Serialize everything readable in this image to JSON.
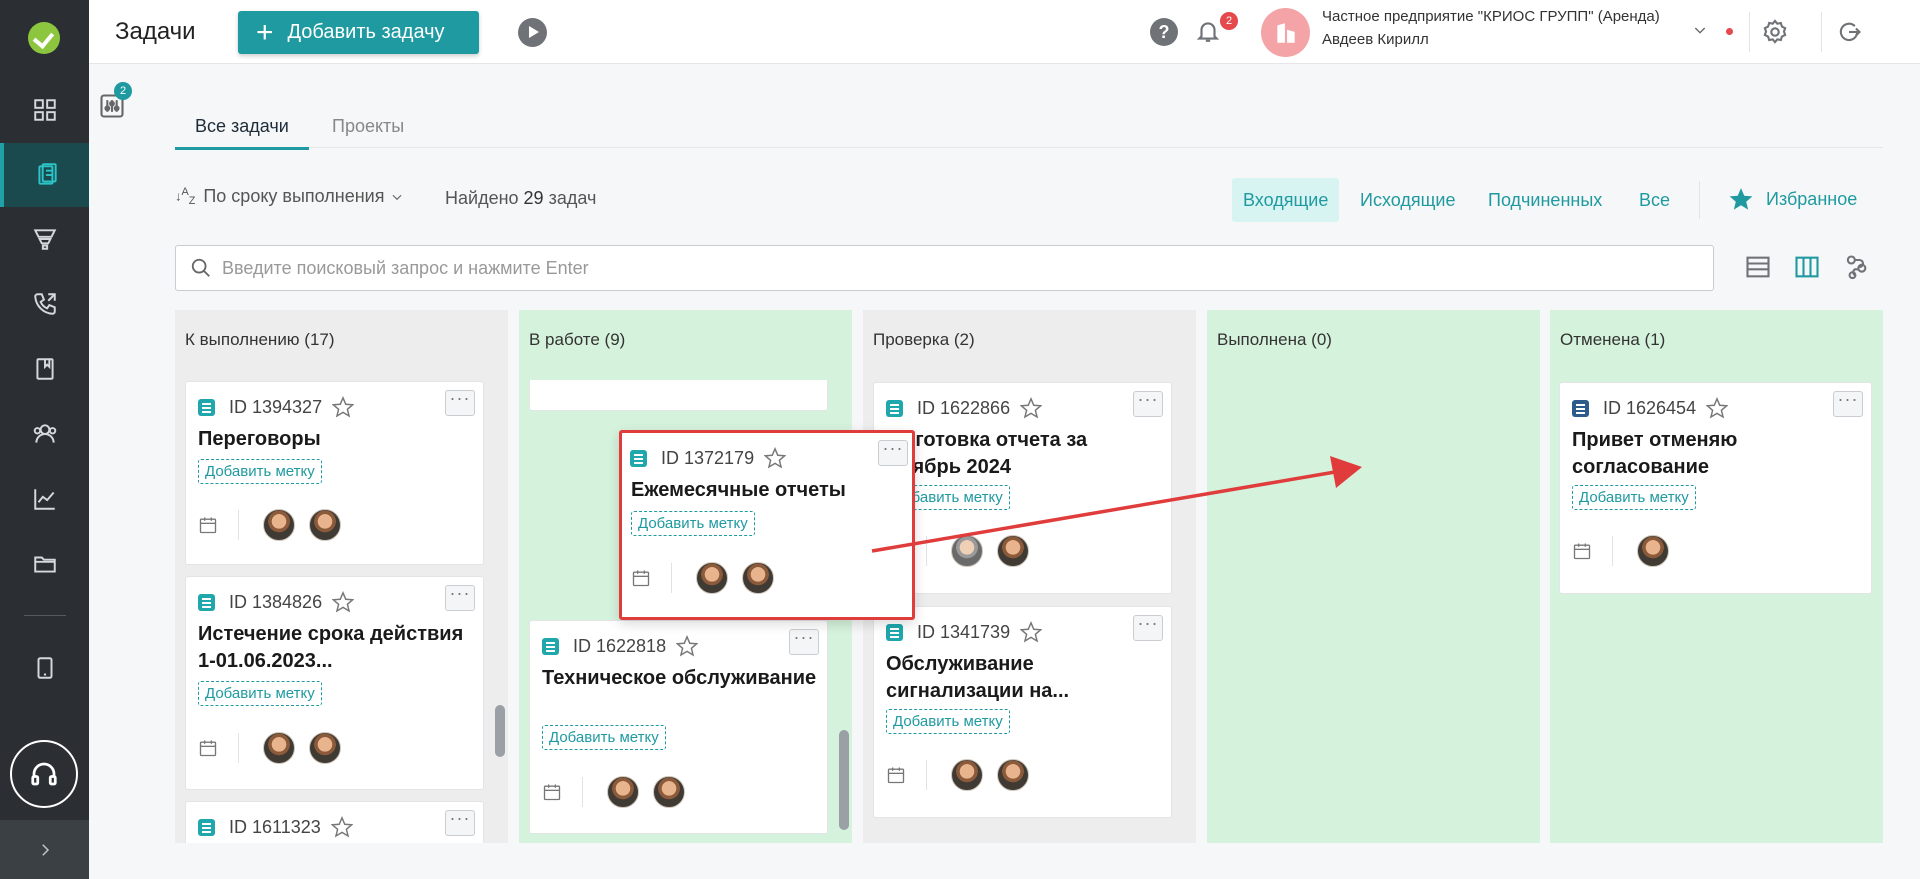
{
  "app": {
    "page_title": "Задачи"
  },
  "header": {
    "add_task_label": "Добавить задачу",
    "notifications_count": "2",
    "org_name": "Частное предприятие \"КРИОС ГРУПП\" (Аренда)",
    "user_name": "Авдеев Кирилл",
    "help_label": "?"
  },
  "filters": {
    "active_count": "2"
  },
  "tabs": [
    {
      "label": "Все задачи"
    },
    {
      "label": "Проекты"
    }
  ],
  "toolbar": {
    "sort_label": "По сроку выполнения",
    "found_prefix": "Найдено",
    "found_count": "29",
    "found_suffix": "задач",
    "filter_tabs": [
      {
        "label": "Входящие"
      },
      {
        "label": "Исходящие"
      },
      {
        "label": "Подчиненных"
      },
      {
        "label": "Все"
      }
    ],
    "favorites_label": "Избранное"
  },
  "search": {
    "placeholder": "Введите поисковый запрос и нажмите Enter",
    "value": ""
  },
  "board": {
    "add_tag_label": "Добавить метку",
    "dots_label": "···",
    "columns": [
      {
        "title": "К выполнению (17)",
        "cards": [
          {
            "id": "ID 1394327",
            "title": "Переговоры"
          },
          {
            "id": "ID 1384826",
            "title": "Истечение срока действия 1-01.06.2023..."
          },
          {
            "id": "ID 1611323",
            "title": ""
          }
        ]
      },
      {
        "title": "В работе (9)",
        "cards": [
          {
            "id": "ID 1622818",
            "title": "Техническое обслуживание"
          }
        ]
      },
      {
        "title": "Проверка (2)",
        "cards": [
          {
            "id": "ID 1622866",
            "title": "...дготовка отчета за ...тябрь 2024"
          },
          {
            "id": "ID 1341739",
            "title": "Обслуживание сигнализации на..."
          }
        ]
      },
      {
        "title": "Выполнена (0)",
        "cards": []
      },
      {
        "title": "Отменена (1)",
        "cards": [
          {
            "id": "ID 1626454",
            "title": "Привет отменяю согласование"
          }
        ]
      }
    ],
    "dragged_card": {
      "id": "ID 1372179",
      "title": "Ежемесячные отчеты"
    }
  },
  "colors": {
    "accent": "#1f9aa0",
    "sidebar": "#2b2f33",
    "column_green": "#d5f2dc",
    "column_gray": "#ededed",
    "annotation": "#e03c3c"
  }
}
